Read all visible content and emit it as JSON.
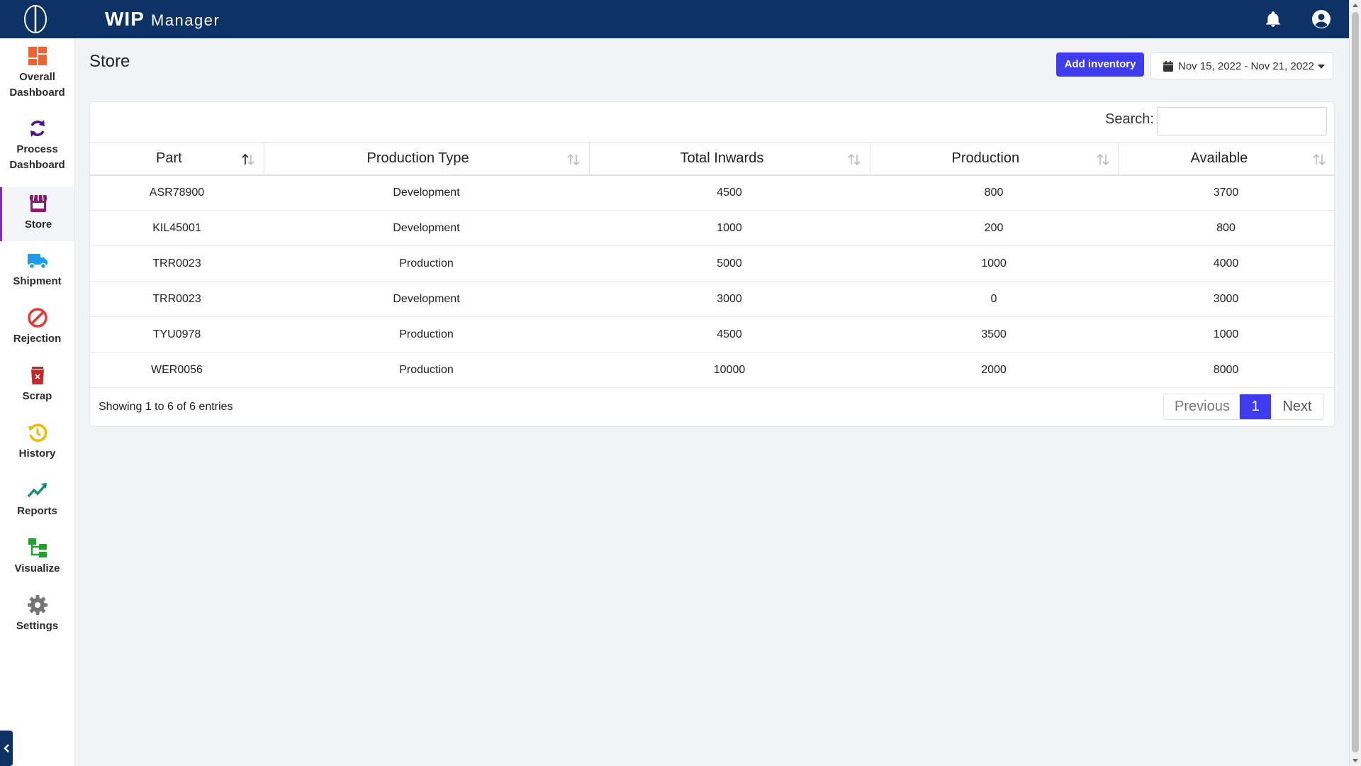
{
  "app": {
    "title": "WIP",
    "subtitle": "Manager"
  },
  "sidebar": {
    "items": [
      {
        "label": "Overall Dashboard",
        "icon": "grid-icon",
        "color": "#f2622e"
      },
      {
        "label": "Process Dashboard",
        "icon": "sync-icon",
        "color": "#4a148c"
      },
      {
        "label": "Store",
        "icon": "store-icon",
        "color": "#8e1a6e",
        "active": true
      },
      {
        "label": "Shipment",
        "icon": "truck-icon",
        "color": "#1e9be9"
      },
      {
        "label": "Rejection",
        "icon": "ban-icon",
        "color": "#e53935"
      },
      {
        "label": "Scrap",
        "icon": "trash-icon",
        "color": "#c62828"
      },
      {
        "label": "History",
        "icon": "history-icon",
        "color": "#f5b800"
      },
      {
        "label": "Reports",
        "icon": "chart-line-icon",
        "color": "#1a8a7a"
      },
      {
        "label": "Visualize",
        "icon": "sitemap-icon",
        "color": "#1ea32d"
      },
      {
        "label": "Settings",
        "icon": "gear-icon",
        "color": "#757575"
      }
    ]
  },
  "page": {
    "title": "Store",
    "add_button": "Add inventory",
    "date_range": "Nov 15, 2022 - Nov 21, 2022"
  },
  "table": {
    "search_label": "Search:",
    "search_value": "",
    "columns": [
      "Part",
      "Production Type",
      "Total Inwards",
      "Production",
      "Available"
    ],
    "rows": [
      [
        "ASR78900",
        "Development",
        "4500",
        "800",
        "3700"
      ],
      [
        "KIL45001",
        "Development",
        "1000",
        "200",
        "800"
      ],
      [
        "TRR0023",
        "Production",
        "5000",
        "1000",
        "4000"
      ],
      [
        "TRR0023",
        "Development",
        "3000",
        "0",
        "3000"
      ],
      [
        "TYU0978",
        "Production",
        "4500",
        "3500",
        "1000"
      ],
      [
        "WER0056",
        "Production",
        "10000",
        "2000",
        "8000"
      ]
    ],
    "info": "Showing 1 to 6 of 6 entries",
    "pager": {
      "previous": "Previous",
      "current": "1",
      "next": "Next"
    }
  }
}
